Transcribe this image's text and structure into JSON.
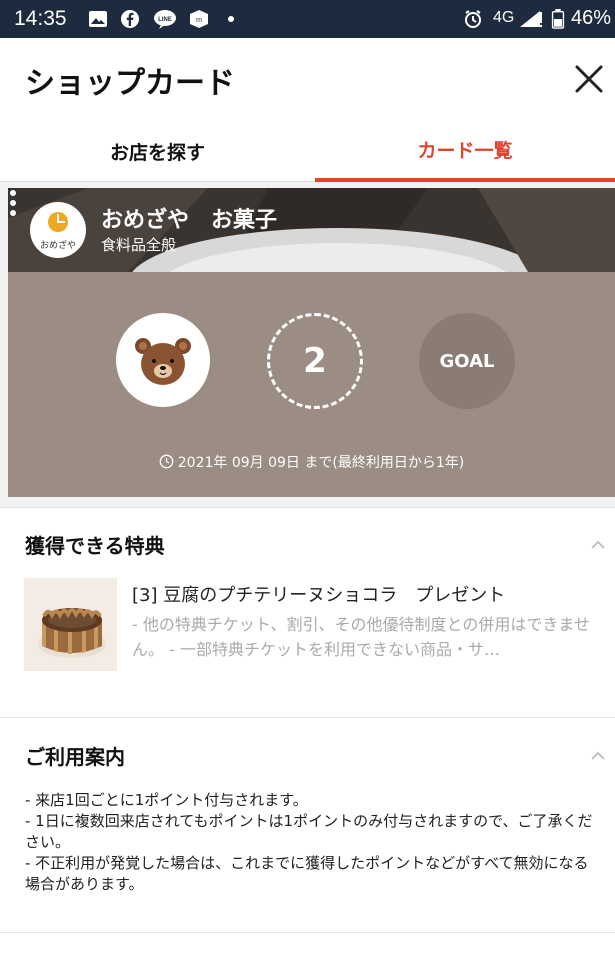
{
  "status_bar": {
    "time": "14:35",
    "network": "4G",
    "battery": "46%"
  },
  "header": {
    "title": "ショップカード"
  },
  "tabs": [
    {
      "label": "お店を探す",
      "active": false
    },
    {
      "label": "カード一覧",
      "active": true
    }
  ],
  "card": {
    "shop_name": "おめざや　お菓子",
    "category": "食料品全般",
    "logo_text": "おめざや",
    "current_points": "2",
    "goal_label": "GOAL",
    "expiry": "2021年 09月 09日 まで(最終利用日から1年)"
  },
  "benefits": {
    "heading": "獲得できる特典",
    "item_title": "[3] 豆腐のプチテリーヌショコラ　プレゼント",
    "item_desc": "- 他の特典チケット、割引、その他優待制度との併用はできません。 - 一部特典チケットを利用できない商品・サ…"
  },
  "info": {
    "heading": "ご利用案内",
    "lines": [
      "- 来店1回ごとに1ポイント付与されます。",
      "- 1日に複数回来店されてもポイントは1ポイントのみ付与されますので、ご了承ください。",
      "- 不正利用が発覚した場合は、これまでに獲得したポイントなどがすべて無効になる場合があります。"
    ]
  },
  "colors": {
    "accent": "#e0432e",
    "card_bg": "#9b8c84",
    "status_bar": "#1e2a3d"
  }
}
